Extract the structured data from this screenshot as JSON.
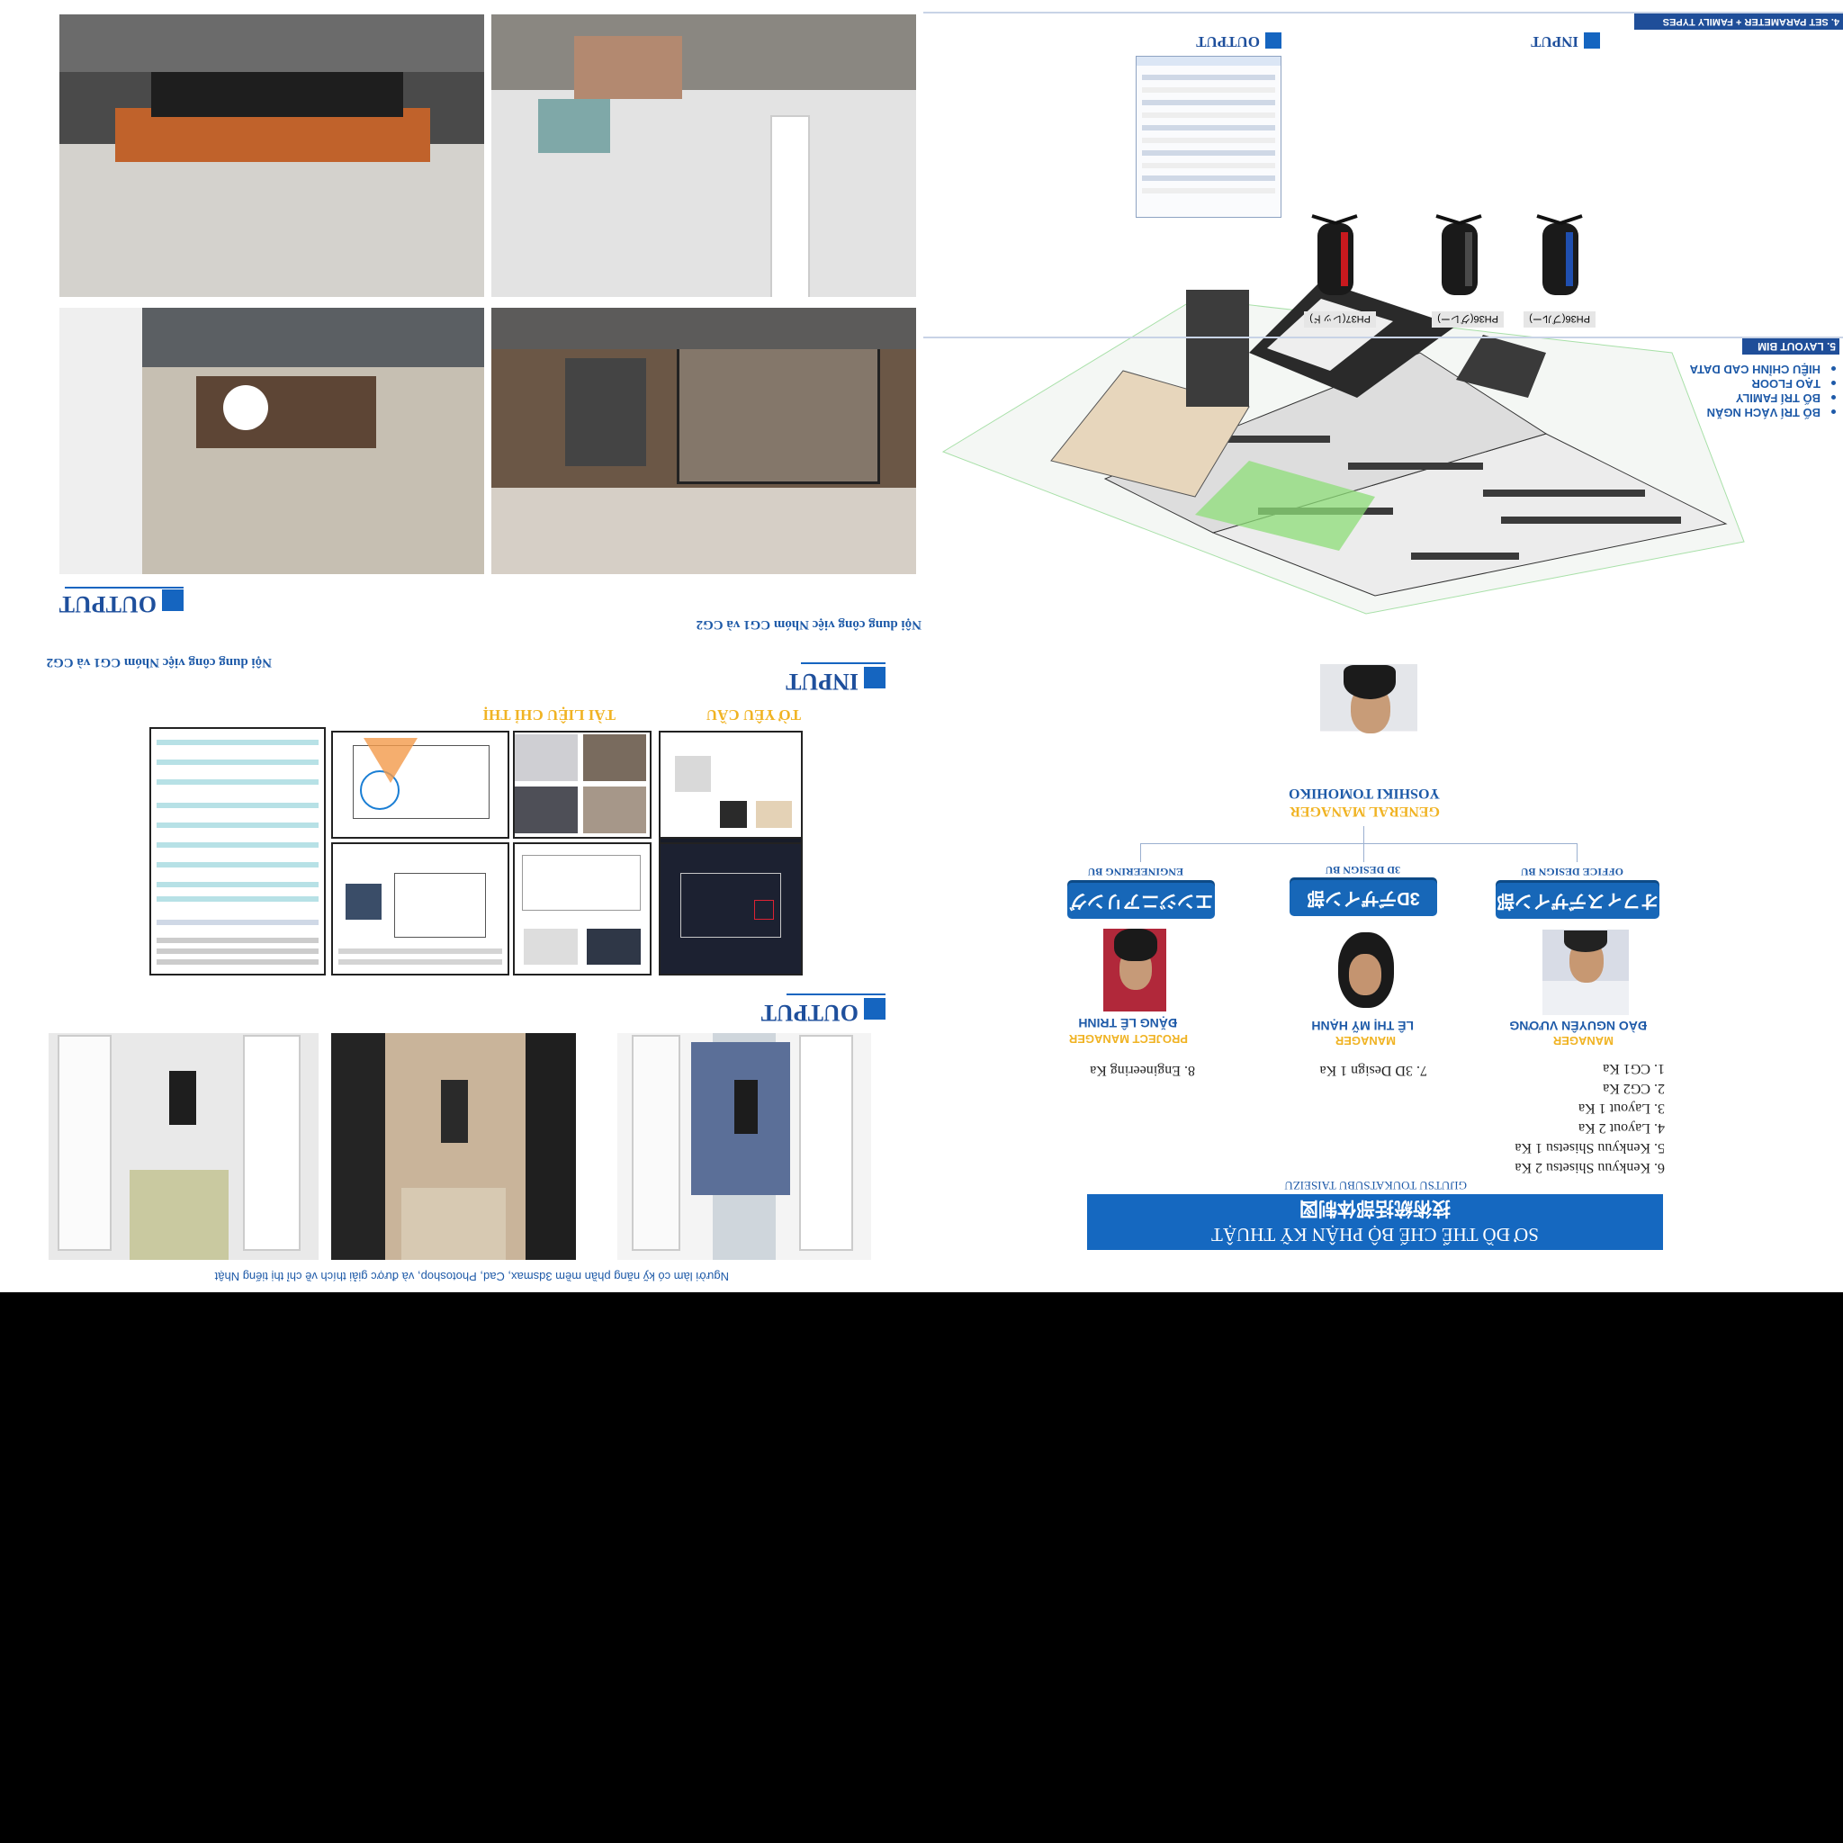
{
  "org_chart": {
    "title_vi": "SƠ ĐỒ THỂ CHẾ BỘ PHẬN KỸ THUẬT",
    "title_jp": "技術統括部体制図",
    "title_romaji": "GIJUTSU TOUKATSUBU TAISEIZU",
    "general_manager": {
      "role": "GENERAL MANAGER",
      "name": "YOSHIKI TOMOHIKO"
    },
    "departments": [
      {
        "jp": "オフィスデザイン部",
        "en": "OFFICE DESIGN BU",
        "manager_name": "ĐÀO NGUYÊN VƯƠNG",
        "manager_role": "MANAGER",
        "sections": [
          "1.  CG1 Ka",
          "2.  CG2 Ka",
          "3.  Layout 1 Ka",
          "4.  Layout 2 Ka",
          "5.  Kenkyuu Shisetsu 1 Ka",
          "6.  Kenkyuu Shisetsu 2 Ka"
        ]
      },
      {
        "jp": "3Dデザイン部",
        "en": "3D DESIGN BU",
        "manager_name": "LÊ THỊ MỸ HẠNH",
        "manager_role": "MANAGER",
        "sections": [
          "7.  3D Design 1 Ka"
        ]
      },
      {
        "jp": "エンジニアリング部",
        "en": "ENGINEERING BU",
        "manager_name": "ĐẶNG LÊ TRINH",
        "manager_role": "PROJECT MANAGER",
        "sections": [
          "8.  Engineering Ka"
        ]
      }
    ]
  },
  "layout_bim": {
    "section_label": "5. LAYOUT BIM",
    "bullets": [
      "HIỆU CHỈNH CAD DATA",
      "TẠO FLOOR",
      "BỐ TRÍ FAMILY",
      "BỐ TRÍ VÁCH NGĂN"
    ]
  },
  "set_parameter": {
    "section_label": "4. SET PARAMETER + FAMILY TYPES",
    "input_label": "INPUT",
    "output_label": "OUTPUT",
    "chairs": [
      {
        "tag": "PH36(ブルー)",
        "color": "#1f4fb0"
      },
      {
        "tag": "PH36(グレー)",
        "color": "#4a4a4a"
      },
      {
        "tag": "PH37(レッド)",
        "color": "#c8191e"
      }
    ]
  },
  "cg_top": {
    "caption": "Người làm có kỹ năng phần mềm 3dsmax, Cad, Photoshop, và được giải thích về chỉ thị tiếng Nhật",
    "output_label": "OUTPUT",
    "input_label": "INPUT",
    "request_label": "TỜ YÊU CẦU",
    "material_label": "TÀI LIỆU CHỈ THỊ",
    "footer": "Nội dung công việc Nhóm CG1 và CG2"
  },
  "cg_bottom": {
    "output_label": "OUTPUT",
    "footer": "Nội dung công việc Nhóm CG1 và CG2"
  },
  "colors": {
    "brand_blue": "#1565c0",
    "accent_yellow": "#f0b323",
    "text_blue": "#1e5aa8"
  }
}
